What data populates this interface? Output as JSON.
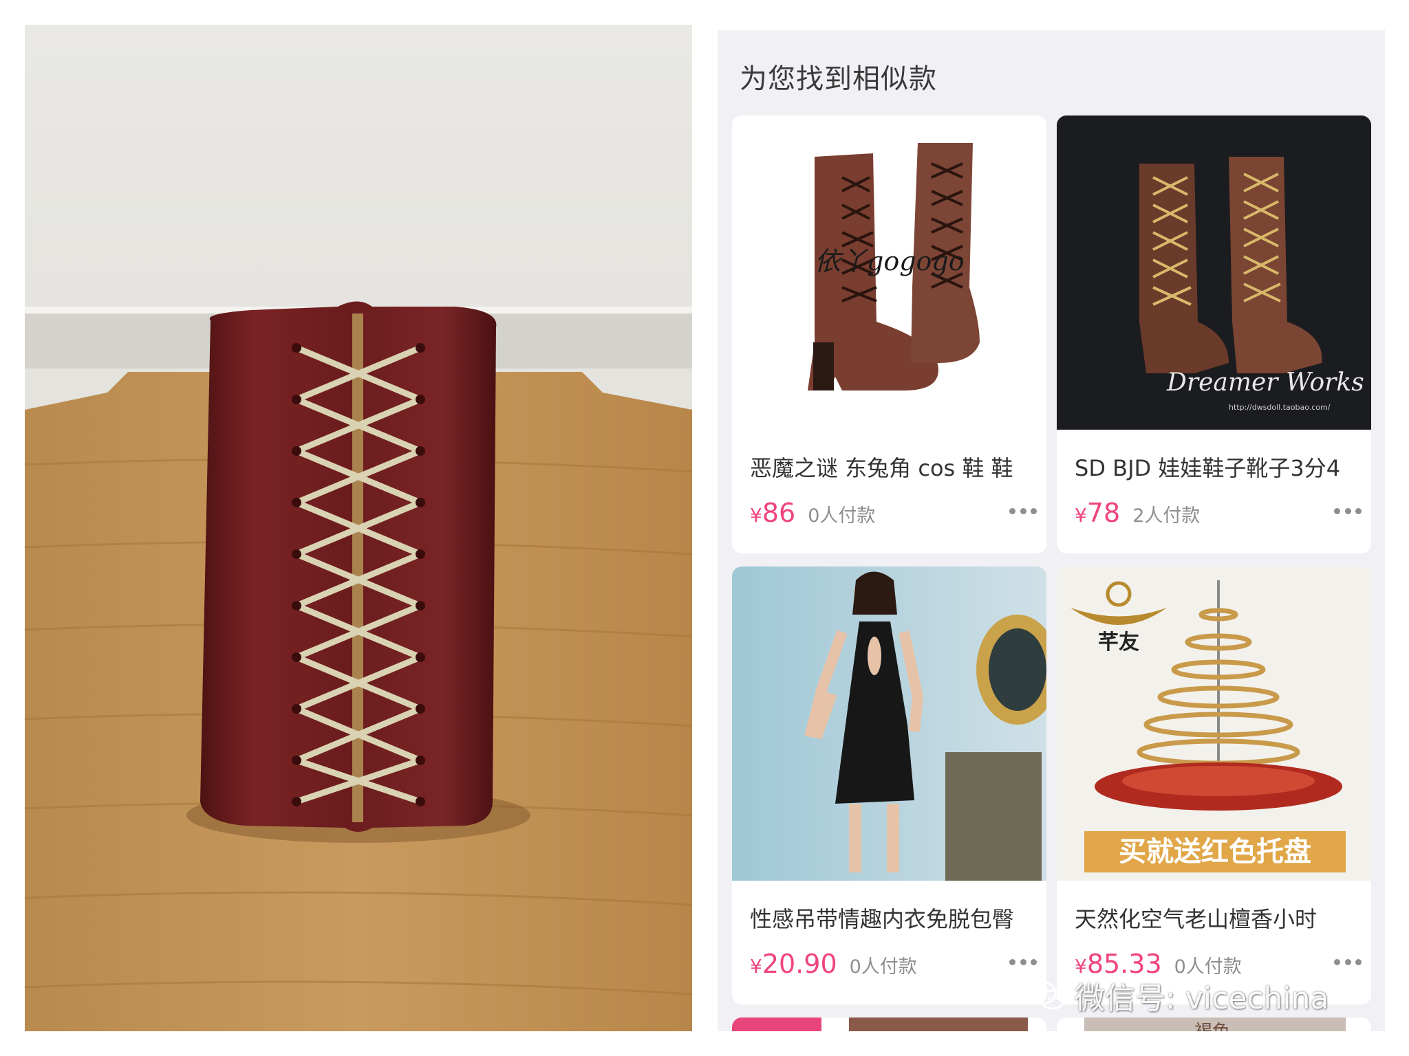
{
  "panel": {
    "title": "为您找到相似款"
  },
  "products": [
    {
      "name": "恶魔之谜 东兔角 cos 鞋 鞋",
      "currency": "¥",
      "price": "86",
      "sold": "0人付款",
      "image_watermark": "依丫gogogo",
      "image_icon": "brown-lace-up-boots-image"
    },
    {
      "name": "SD BJD 娃娃鞋子靴子3分4",
      "currency": "¥",
      "price": "78",
      "sold": "2人付款",
      "image_watermark": "Dreamer Works",
      "image_watermark_url": "http://dwsdoll.taobao.com/",
      "image_icon": "doll-boots-image"
    },
    {
      "name": "性感吊带情趣内衣免脱包臀",
      "currency": "¥",
      "price": "20.90",
      "sold": "0人付款",
      "image_icon": "lingerie-model-image"
    },
    {
      "name": "天然化空气老山檀香小时",
      "currency": "¥",
      "price": "85.33",
      "sold": "0人付款",
      "image_brand": "芊友",
      "image_banner": "买就送红色托盘",
      "image_icon": "incense-coil-image"
    }
  ],
  "partial_next_row": {
    "visible_text": "褐色"
  },
  "watermark": {
    "text": "微信号: vicechina",
    "icon": "wechat-icon"
  },
  "colors": {
    "price": "#f0447c",
    "panel_bg": "#f1f0f5",
    "card_bg": "#ffffff",
    "leather": "#6e1d1e",
    "lace": "#d9d3b3"
  }
}
